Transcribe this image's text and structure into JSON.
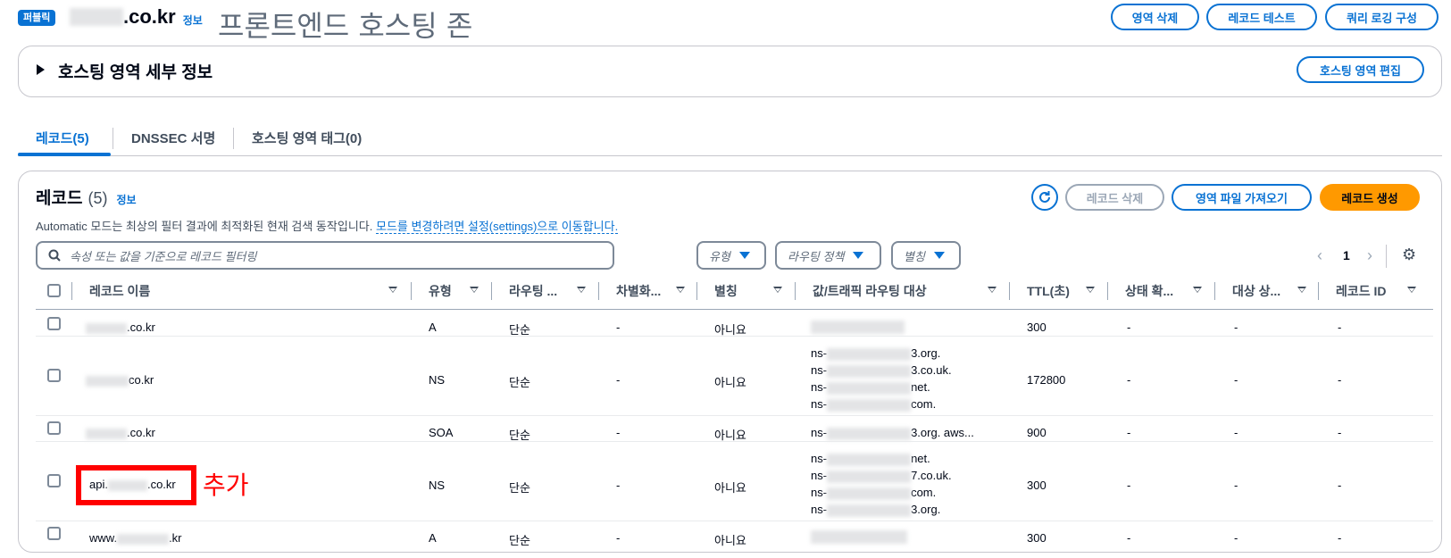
{
  "header": {
    "badge": "퍼블릭",
    "domain_suffix": ".co.kr",
    "info_label": "정보",
    "page_title": "프론트엔드 호스팅 존",
    "buttons": {
      "delete_zone": "영역 삭제",
      "test_record": "레코드 테스트",
      "query_logging": "쿼리 로깅 구성"
    }
  },
  "zone_details": {
    "title": "호스팅 영역 세부 정보",
    "edit_button": "호스팅 영역 편집"
  },
  "tabs": [
    {
      "label": "레코드(5)",
      "active": true
    },
    {
      "label": "DNSSEC 서명",
      "active": false
    },
    {
      "label": "호스팅 영역 태그(0)",
      "active": false
    }
  ],
  "records_panel": {
    "title": "레코드",
    "count": "(5)",
    "info_label": "정보",
    "description": "Automatic 모드는 최상의 필터 결과에 최적화된 현재 검색 동작입니다.",
    "description_link": "모드를 변경하려면 설정(settings)으로 이동합니다.",
    "buttons": {
      "delete": "레코드 삭제",
      "import": "영역 파일 가져오기",
      "create": "레코드 생성"
    },
    "search_placeholder": "속성 또는 값을 기준으로 레코드 필터링",
    "filters": {
      "type": "유형",
      "routing": "라우팅 정책",
      "alias": "별칭"
    },
    "pagination": {
      "page": "1"
    }
  },
  "table": {
    "columns": [
      "레코드 이름",
      "유형",
      "라우팅 ...",
      "차별화...",
      "별칭",
      "값/트래픽 라우팅 대상",
      "TTL(초)",
      "상태 확...",
      "대상 상...",
      "레코드 ID"
    ],
    "rows": [
      {
        "name_prefix": "",
        "name_suffix": ".co.kr",
        "type": "A",
        "routing": "단순",
        "diff": "-",
        "alias": "아니요",
        "values": [],
        "ttl": "300",
        "health": "-",
        "target": "-",
        "id": "-"
      },
      {
        "name_prefix": "",
        "name_suffix": "co.kr",
        "type": "NS",
        "routing": "단순",
        "diff": "-",
        "alias": "아니요",
        "values": [
          "3.org.",
          "3.co.uk.",
          "net.",
          "com."
        ],
        "ttl": "172800",
        "health": "-",
        "target": "-",
        "id": "-"
      },
      {
        "name_prefix": "",
        "name_suffix": ".co.kr",
        "type": "SOA",
        "routing": "단순",
        "diff": "-",
        "alias": "아니요",
        "values": [
          "3.org. aws..."
        ],
        "ttl": "900",
        "health": "-",
        "target": "-",
        "id": "-"
      },
      {
        "name_prefix": "api.",
        "name_suffix": ".co.kr",
        "type": "NS",
        "routing": "단순",
        "diff": "-",
        "alias": "아니요",
        "values": [
          "net.",
          "7.co.uk.",
          "com.",
          "3.org."
        ],
        "ttl": "300",
        "health": "-",
        "target": "-",
        "id": "-"
      },
      {
        "name_prefix": "www.",
        "name_suffix": ".kr",
        "type": "A",
        "routing": "단순",
        "diff": "-",
        "alias": "아니요",
        "values": [],
        "ttl": "300",
        "health": "-",
        "target": "-",
        "id": "-"
      }
    ],
    "ns_prefix": "ns-"
  },
  "annotation": {
    "label": "추가",
    "color": "#ff0000"
  },
  "colors": {
    "accent": "#0972d3",
    "primary_button": "#ff9900"
  }
}
